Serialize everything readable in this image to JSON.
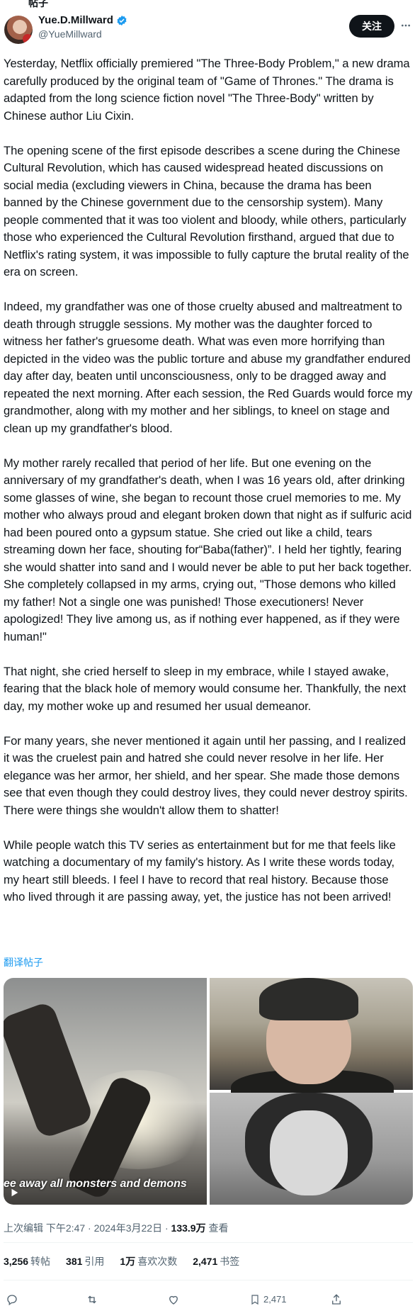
{
  "top_fragment": "帖子",
  "author": {
    "name": "Yue.D.Millward",
    "handle": "@YueMillward",
    "follow_label": "关注"
  },
  "post": {
    "paragraphs": [
      "Yesterday, Netflix officially premiered \"The Three-Body Problem,\" a new drama carefully produced by the original team of \"Game of Thrones.\" The drama is adapted from the long science fiction novel \"The Three-Body\" written by Chinese author Liu Cixin.",
      "The opening scene of the first episode describes a scene during the Chinese Cultural Revolution, which has caused widespread heated discussions on social media (excluding viewers in China, because the drama has been banned by the Chinese government due to the censorship system). Many people commented that it was too violent and bloody, while others, particularly those who experienced the Cultural Revolution firsthand, argued that due to Netflix's rating system, it was impossible to fully capture the brutal reality of the era on screen.",
      "Indeed, my grandfather was one of those cruelty abused and maltreatment to death through struggle sessions. My mother was the daughter forced to witness her father's gruesome death. What was even more horrifying than depicted in the video was the public torture and abuse my grandfather endured day after day, beaten until unconsciousness, only to be dragged away and repeated the next morning. After each session, the Red Guards would force my grandmother, along with my mother and her siblings, to kneel on stage and clean up my grandfather's blood.",
      "My mother rarely recalled that period of her life. But one evening on the anniversary of my grandfather's death, when I was 16 years old, after drinking some glasses of wine, she began to recount those cruel memories to me. My mother who always proud and elegant broken down that night as if sulfuric acid had been poured onto a gypsum statue. She cried out like a child, tears streaming down her face, shouting for“Baba(father)”. I held her tightly, fearing she would shatter into sand and I would never be able to put her back together. She completely collapsed in my arms, crying out, \"Those demons who killed my father! Not a single one was punished! Those executioners! Never apologized! They live among us, as if nothing ever happened, as if they were human!\"",
      "That night, she cried herself to sleep in my embrace, while I stayed awake, fearing that the black hole of memory would consume her. Thankfully, the next day, my mother woke up and resumed her usual demeanor.",
      "For many years, she never mentioned it again until her passing, and I realized it was the cruelest pain and hatred she could never resolve in her life. Her elegance was her armor, her shield, and her spear. She made those demons see that even though they could destroy lives, they could never destroy spirits. There were things she wouldn't allow them to shatter!",
      "While people watch this TV series as entertainment but for me that feels like watching a documentary of my family's history. As I write these words today, my heart still bleeds. I feel I have to record that real history. Because those who lived through it are passing away, yet, the justice has not been arrived!"
    ],
    "translate_label": "翻译帖子",
    "video_caption": "ee away all monsters and demons"
  },
  "meta": {
    "edited": "上次编辑 下午2:47 · 2024年3月22日 · ",
    "views_count": "133.9万",
    "views_label": " 查看"
  },
  "stats": [
    {
      "count": "3,256",
      "label": "转帖"
    },
    {
      "count": "381",
      "label": "引用"
    },
    {
      "count": "1万",
      "label": "喜欢次数"
    },
    {
      "count": "2,471",
      "label": "书签"
    }
  ],
  "actions": {
    "bookmark_count": "2,471"
  },
  "colors": {
    "accent": "#1d9bf0",
    "text": "#0f1419",
    "muted": "#536471"
  }
}
